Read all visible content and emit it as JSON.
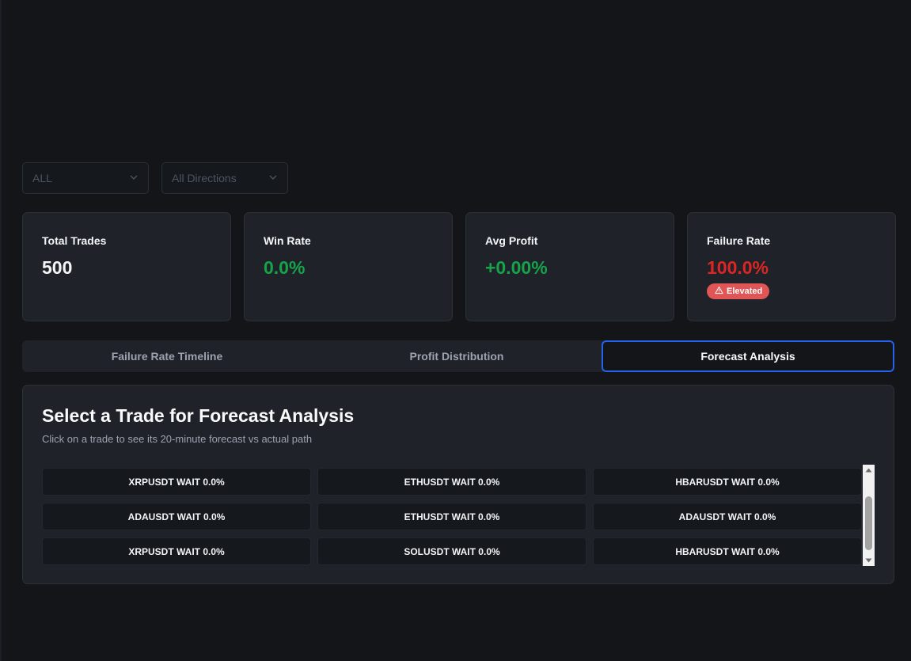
{
  "filters": {
    "market": "ALL",
    "direction": "All Directions"
  },
  "stats": [
    {
      "label": "Total Trades",
      "value": "500",
      "tone": "white"
    },
    {
      "label": "Win Rate",
      "value": "0.0%",
      "tone": "green"
    },
    {
      "label": "Avg Profit",
      "value": "+0.00%",
      "tone": "green"
    },
    {
      "label": "Failure Rate",
      "value": "100.0%",
      "tone": "red",
      "badge": "Elevated"
    }
  ],
  "tabs": [
    {
      "label": "Failure Rate Timeline",
      "active": false
    },
    {
      "label": "Profit Distribution",
      "active": false
    },
    {
      "label": "Forecast Analysis",
      "active": true
    }
  ],
  "forecast": {
    "title": "Select a Trade for Forecast Analysis",
    "subtitle": "Click on a trade to see its 20-minute forecast vs actual path",
    "trades": [
      "XRPUSDT WAIT 0.0%",
      "ETHUSDT WAIT 0.0%",
      "HBARUSDT WAIT 0.0%",
      "ADAUSDT WAIT 0.0%",
      "ETHUSDT WAIT 0.0%",
      "ADAUSDT WAIT 0.0%",
      "XRPUSDT WAIT 0.0%",
      "SOLUSDT WAIT 0.0%",
      "HBARUSDT WAIT 0.0%"
    ]
  },
  "colors": {
    "accent": "#2563eb",
    "positive": "#16a34a",
    "negative": "#dc2626",
    "badge": "#e05555"
  }
}
